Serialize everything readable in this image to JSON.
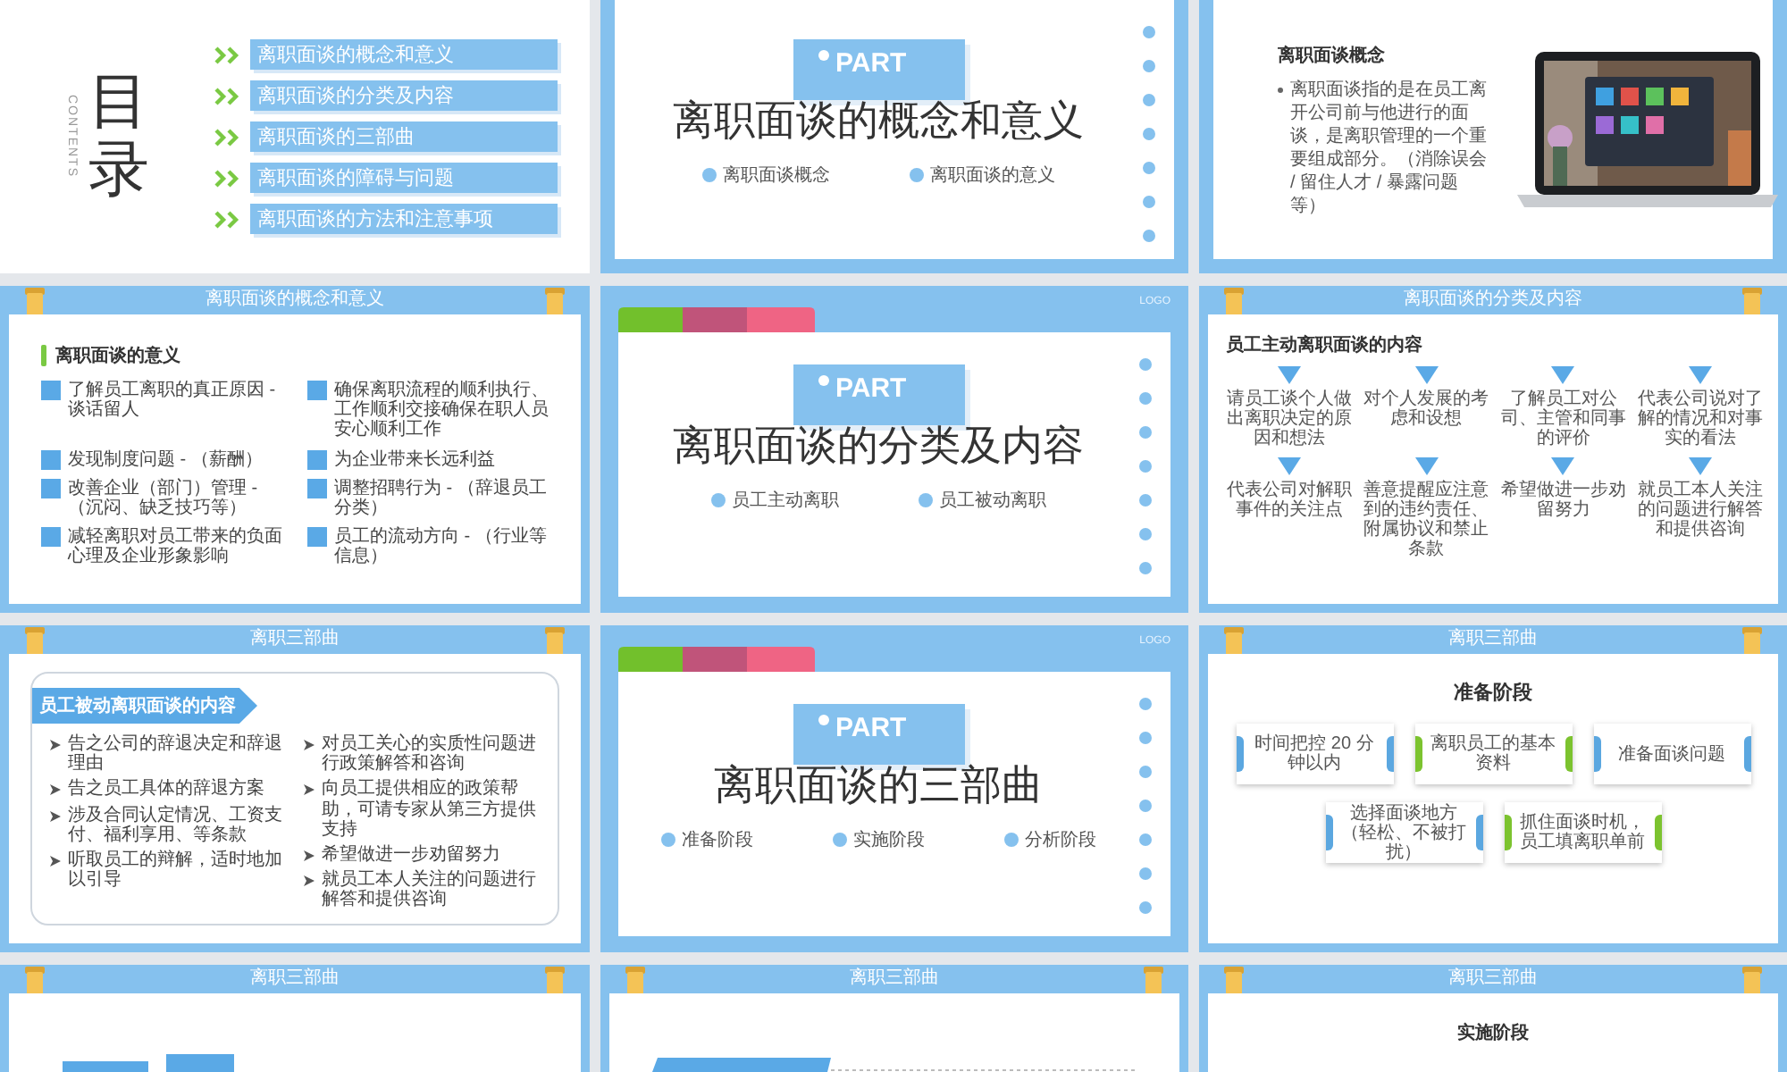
{
  "slides": [
    {
      "kind": "contents",
      "title": "目录",
      "subtitle": "CONTENTS",
      "items": [
        "离职面谈的概念和意义",
        "离职面谈的分类及内容",
        "离职面谈的三部曲",
        "离职面谈的障碍与问题",
        "离职面谈的方法和注意事项"
      ]
    },
    {
      "kind": "section",
      "part": "PART",
      "title": "离职面谈的概念和意义",
      "points": [
        "离职面谈概念",
        "离职面谈的意义"
      ]
    },
    {
      "kind": "concept",
      "heading": "离职面谈概念",
      "bullet": "离职面谈指的是在员工离开公司前与他进行的面谈，是离职管理的一个重要组成部分。（消除误会 / 留住人才 / 暴露问题等）"
    },
    {
      "kind": "grid_list",
      "header": "离职面谈的概念和意义",
      "heading": "离职面谈的意义",
      "items": [
        "了解员工离职的真正原因 - 谈话留人",
        "确保离职流程的顺利执行、工作顺利交接确保在职人员安心顺利工作",
        "发现制度问题 - （薪酬）",
        "为企业带来长远利益",
        "改善企业（部门）管理 - （沉闷、缺乏技巧等）",
        "调整招聘行为 - （辞退员工分类）",
        "减轻离职对员工带来的负面心理及企业形象影响",
        "员工的流动方向 - （行业等信息）"
      ]
    },
    {
      "kind": "section",
      "logo": "LOGO",
      "part": "PART",
      "title": "离职面谈的分类及内容",
      "points": [
        "员工主动离职",
        "员工被动离职"
      ]
    },
    {
      "kind": "triangles",
      "header": "离职面谈的分类及内容",
      "heading": "员工主动离职面谈的内容",
      "items": [
        "请员工谈个人做出离职决定的原因和想法",
        "对个人发展的考虑和设想",
        "了解员工对公司、主管和同事的评价",
        "代表公司说对了解的情况和对事实的看法",
        "代表公司对解职事件的关注点",
        "善意提醒应注意到的违约责任、附属协议和禁止条款",
        "希望做进一步劝留努力",
        "就员工本人关注的问题进行解答和提供咨询"
      ]
    },
    {
      "kind": "boxed_list",
      "header": "离职三部曲",
      "tag": "员工被动离职面谈的内容",
      "columns": [
        [
          "告之公司的辞退决定和辞退理由",
          "告之员工具体的辞退方案",
          "涉及合同认定情况、工资支付、福利享用、等条款",
          "听取员工的辩解，适时地加以引导"
        ],
        [
          "对员工关心的实质性问题进行政策解答和咨询",
          "向员工提供相应的政策帮助，可请专家从第三方提供支持",
          "希望做进一步劝留努力",
          "就员工本人关注的问题进行解答和提供咨询"
        ]
      ]
    },
    {
      "kind": "section",
      "logo": "LOGO",
      "part": "PART",
      "title": "离职面谈的三部曲",
      "points": [
        "准备阶段",
        "实施阶段",
        "分析阶段"
      ]
    },
    {
      "kind": "cards",
      "header": "离职三部曲",
      "heading": "准备阶段",
      "rows": [
        [
          {
            "text": "时间把控 20 分钟以内",
            "color": "#5ba7e0"
          },
          {
            "text": "离职员工的基本资料",
            "color": "#7cc32f"
          },
          {
            "text": "准备面谈问题",
            "color": "#5ba7e0"
          }
        ],
        [
          {
            "text": "选择面谈地方（轻松、不被打扰）",
            "color": "#5ba7e0"
          },
          {
            "text": "抓住面谈时机，员工填离职单前",
            "color": "#7cc32f"
          }
        ]
      ]
    },
    {
      "kind": "partial_tags",
      "header": "离职三部曲"
    },
    {
      "kind": "partial_banner",
      "header": "离职三部曲"
    },
    {
      "kind": "partial_heading",
      "header": "离职三部曲",
      "heading": "实施阶段"
    }
  ]
}
